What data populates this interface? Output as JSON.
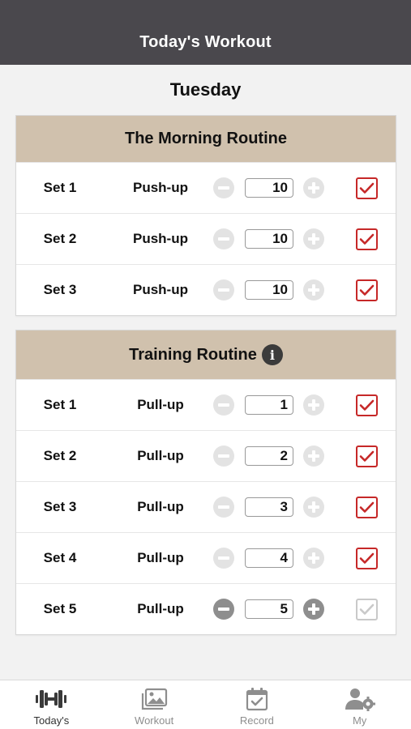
{
  "header": {
    "title": "Today's Workout"
  },
  "day": "Tuesday",
  "routines": [
    {
      "title": "The Morning Routine",
      "has_info": false,
      "sets": [
        {
          "set": "Set 1",
          "exercise": "Push-up",
          "reps": "10",
          "done": true
        },
        {
          "set": "Set 2",
          "exercise": "Push-up",
          "reps": "10",
          "done": true
        },
        {
          "set": "Set 3",
          "exercise": "Push-up",
          "reps": "10",
          "done": true
        }
      ]
    },
    {
      "title": "Training Routine",
      "has_info": true,
      "sets": [
        {
          "set": "Set 1",
          "exercise": "Pull-up",
          "reps": "1",
          "done": true
        },
        {
          "set": "Set 2",
          "exercise": "Pull-up",
          "reps": "2",
          "done": true
        },
        {
          "set": "Set 3",
          "exercise": "Pull-up",
          "reps": "3",
          "done": true
        },
        {
          "set": "Set 4",
          "exercise": "Pull-up",
          "reps": "4",
          "done": true
        },
        {
          "set": "Set 5",
          "exercise": "Pull-up",
          "reps": "5",
          "done": false
        }
      ]
    }
  ],
  "tabs": [
    {
      "label": "Today's",
      "icon": "dumbbell-icon",
      "active": true
    },
    {
      "label": "Workout",
      "icon": "gallery-icon",
      "active": false
    },
    {
      "label": "Record",
      "icon": "calendar-check-icon",
      "active": false
    },
    {
      "label": "My",
      "icon": "user-settings-icon",
      "active": false
    }
  ],
  "colors": {
    "header_bg": "#4a484d",
    "routine_header_bg": "#d0c1ad",
    "check_red": "#c62828"
  }
}
